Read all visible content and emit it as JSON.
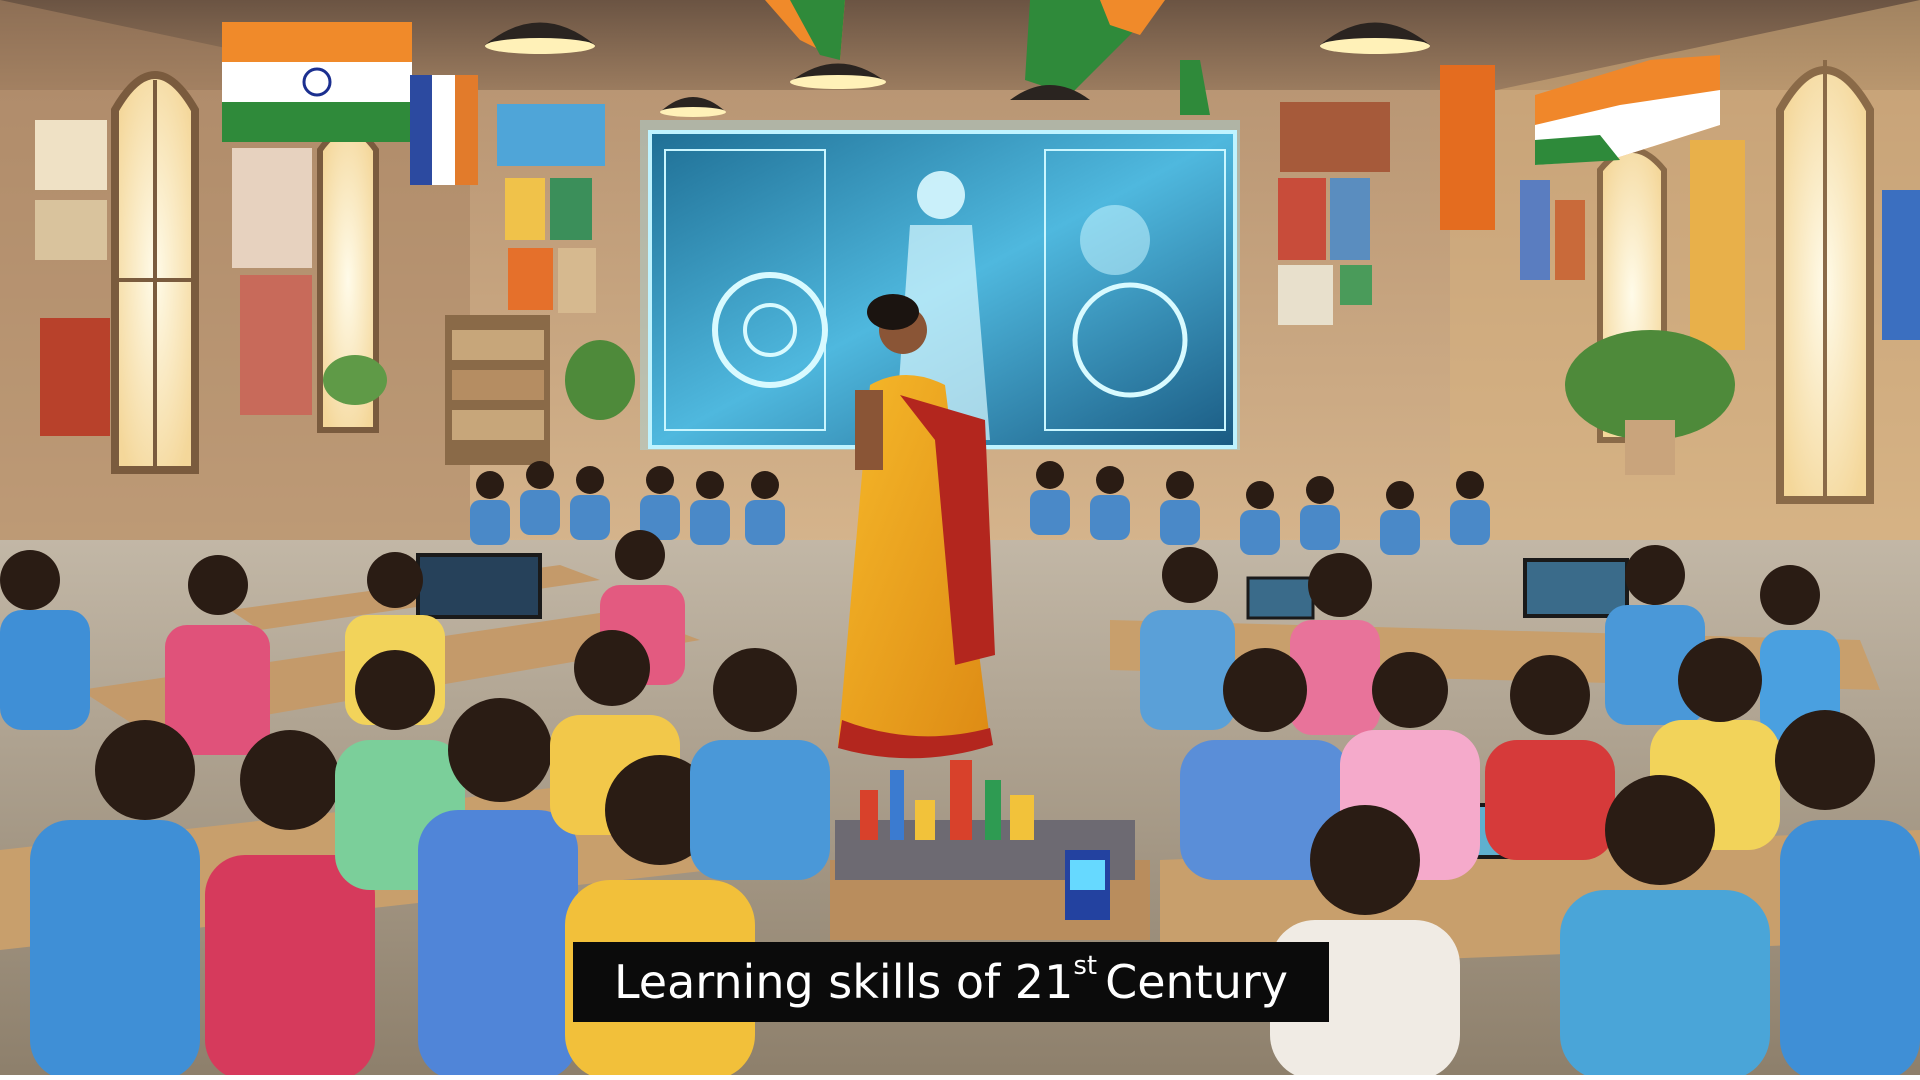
{
  "caption": {
    "prefix": "Learning skills of 21",
    "superscript": "st",
    "suffix": "Century"
  },
  "scene": {
    "description_icon": "classroom-illustration",
    "colors": {
      "wall": "#c9a47c",
      "window_light": "#fff4d6",
      "screen_glow": "#8fe6ff",
      "saree_yellow": "#f2a81c",
      "saree_red": "#b3261e",
      "shirt_blue": "#3f8fd6",
      "floor": "#cfc6b8",
      "caption_bg": "#0b0b0b"
    }
  }
}
